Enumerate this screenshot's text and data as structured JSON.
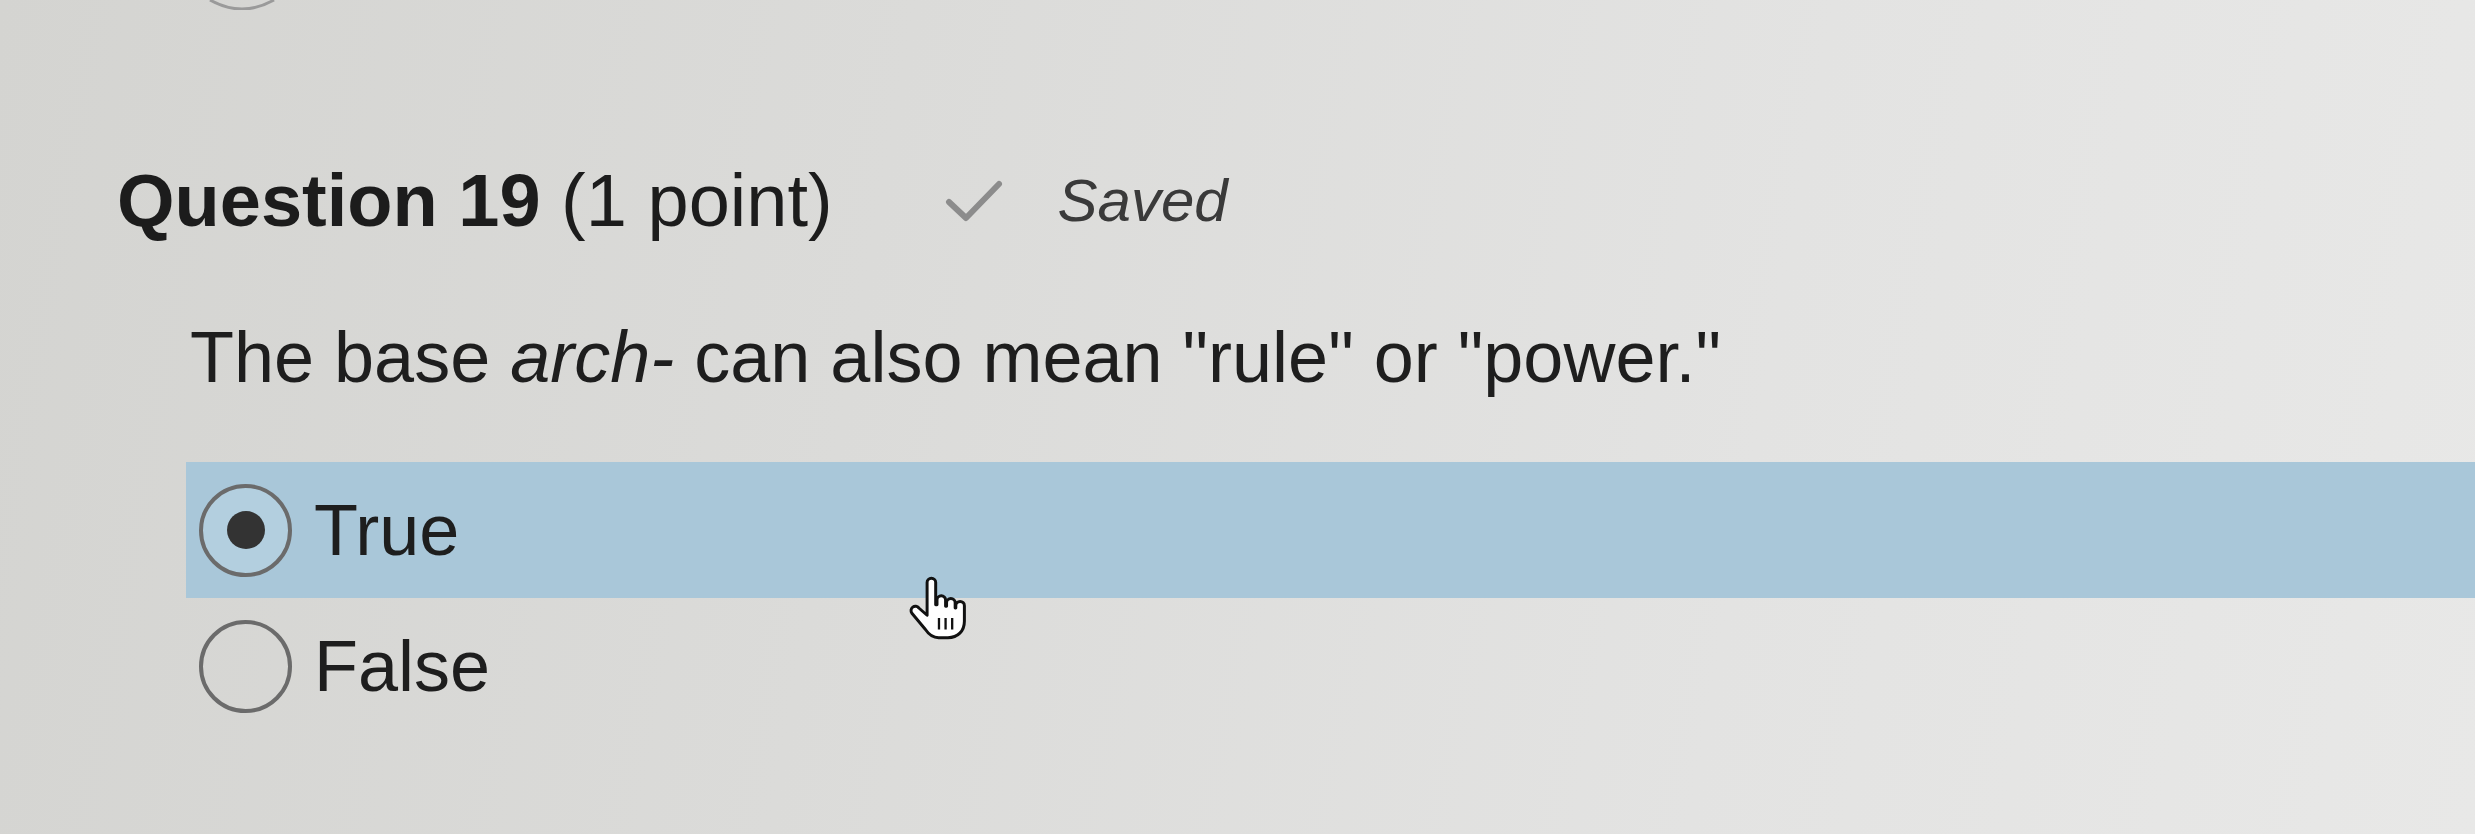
{
  "question": {
    "title": "**Question 19** (1 point)",
    "saved": true,
    "status": "Saved",
    "text": "The base *arch-* can also mean \"rule\" or \"power.\""
  },
  "options": [
    {
      "label": "True",
      "selected": true
    },
    {
      "label": "False",
      "selected": false
    }
  ]
}
